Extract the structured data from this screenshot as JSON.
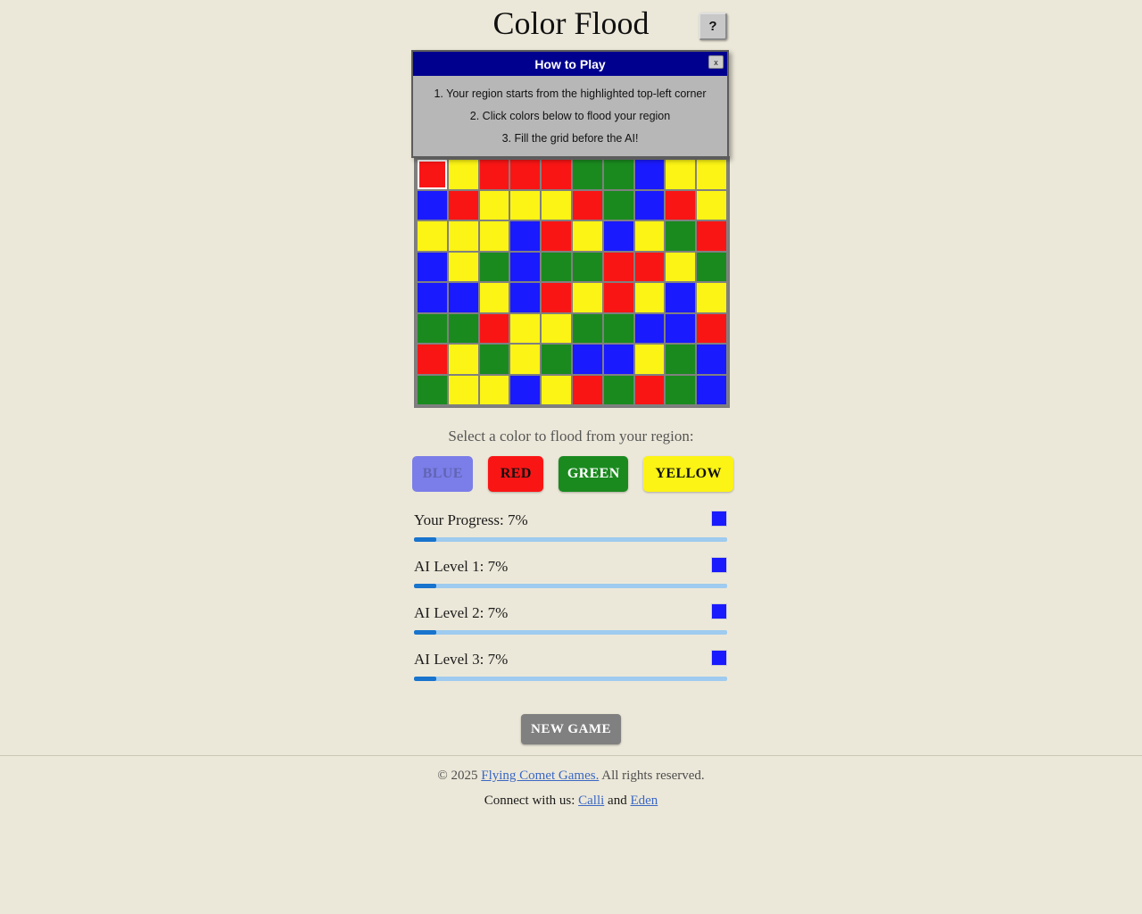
{
  "header": {
    "title": "Color Flood",
    "help_button_label": "?"
  },
  "modal": {
    "title": "How to Play",
    "close_label": "x",
    "steps": [
      "1. Your region starts from the highlighted top-left corner",
      "2. Click colors below to flood your region",
      "3. Fill the grid before the AI!"
    ]
  },
  "palette": {
    "BLUE": "#1a1aff",
    "RED": "#fa1515",
    "GREEN": "#1a8a1f",
    "YELLOW": "#fcf414",
    "BLUE_DISABLED": "#7b7ee8"
  },
  "board": {
    "rows": 8,
    "cols": 10,
    "cells": [
      [
        "RED",
        "YELLOW",
        "RED",
        "RED",
        "RED",
        "GREEN",
        "GREEN",
        "BLUE",
        "YELLOW",
        "YELLOW"
      ],
      [
        "BLUE",
        "RED",
        "YELLOW",
        "YELLOW",
        "YELLOW",
        "RED",
        "GREEN",
        "BLUE",
        "RED",
        "YELLOW"
      ],
      [
        "YELLOW",
        "YELLOW",
        "YELLOW",
        "BLUE",
        "RED",
        "YELLOW",
        "BLUE",
        "YELLOW",
        "GREEN",
        "RED"
      ],
      [
        "BLUE",
        "YELLOW",
        "GREEN",
        "BLUE",
        "GREEN",
        "GREEN",
        "RED",
        "RED",
        "YELLOW",
        "GREEN"
      ],
      [
        "BLUE",
        "BLUE",
        "YELLOW",
        "BLUE",
        "RED",
        "YELLOW",
        "RED",
        "YELLOW",
        "BLUE",
        "YELLOW"
      ],
      [
        "GREEN",
        "GREEN",
        "RED",
        "YELLOW",
        "YELLOW",
        "GREEN",
        "GREEN",
        "BLUE",
        "BLUE",
        "RED"
      ],
      [
        "RED",
        "YELLOW",
        "GREEN",
        "YELLOW",
        "GREEN",
        "BLUE",
        "BLUE",
        "YELLOW",
        "GREEN",
        "BLUE"
      ],
      [
        "GREEN",
        "YELLOW",
        "YELLOW",
        "BLUE",
        "YELLOW",
        "RED",
        "GREEN",
        "RED",
        "GREEN",
        "BLUE"
      ]
    ]
  },
  "chooser": {
    "prompt": "Select a color to flood from your region:",
    "buttons": [
      {
        "label": "BLUE",
        "color_key": "BLUE",
        "disabled": true
      },
      {
        "label": "RED",
        "color_key": "RED",
        "disabled": false
      },
      {
        "label": "GREEN",
        "color_key": "GREEN",
        "disabled": false
      },
      {
        "label": "YELLOW",
        "color_key": "YELLOW",
        "disabled": false
      }
    ]
  },
  "progress": [
    {
      "label": "Your Progress: 7%",
      "percent": 7,
      "swatch_color": "#1a1aff"
    },
    {
      "label": "AI Level 1: 7%",
      "percent": 7,
      "swatch_color": "#1a1aff"
    },
    {
      "label": "AI Level 2: 7%",
      "percent": 7,
      "swatch_color": "#1a1aff"
    },
    {
      "label": "AI Level 3: 7%",
      "percent": 7,
      "swatch_color": "#1a1aff"
    }
  ],
  "actions": {
    "new_game_label": "NEW GAME"
  },
  "footer": {
    "copyright_prefix": "© 2025 ",
    "company_link": "Flying Comet Games.",
    "copyright_suffix": " All rights reserved.",
    "connect_prefix": "Connect with us: ",
    "connect_link_1": "Calli",
    "connect_joiner": " and ",
    "connect_link_2": "Eden"
  }
}
